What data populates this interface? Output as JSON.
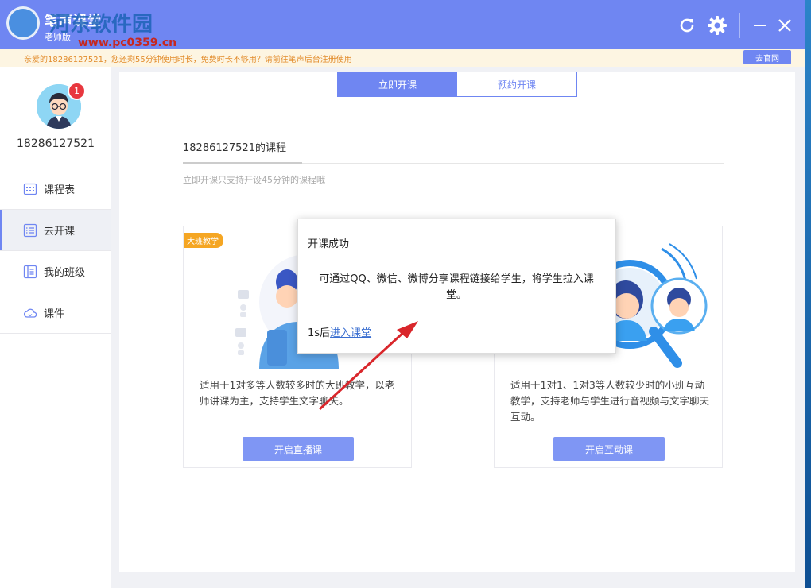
{
  "titlebar": {
    "title": "笔声课堂",
    "subtitle": "老师版",
    "watermark": "河东软件园",
    "watermark_url": "www.pc0359.cn",
    "refresh_icon": "refresh-icon",
    "settings_icon": "gear-icon",
    "minimize_icon": "minimize-icon",
    "close_icon": "close-icon"
  },
  "notice": {
    "text": "亲爱的18286127521，您还剩55分钟使用时长，免费时长不够用？请前往笔声后台注册使用",
    "site_button": "去官网"
  },
  "sidebar": {
    "notification_count": "1",
    "username": "18286127521",
    "items": [
      {
        "label": "课程表",
        "icon": "calendar-icon"
      },
      {
        "label": "去开课",
        "icon": "list-icon"
      },
      {
        "label": "我的班级",
        "icon": "class-icon"
      },
      {
        "label": "课件",
        "icon": "cloud-icon"
      }
    ],
    "active_index": 1
  },
  "main": {
    "tabs": [
      {
        "label": "立即开课",
        "active": true
      },
      {
        "label": "预约开课",
        "active": false
      }
    ],
    "course_title": "18286127521的课程",
    "hint": "立即开课只支持开设45分钟的课程哦",
    "cards": [
      {
        "tag": "大班教学",
        "desc": "适用于1对多等人数较多时的大班教学，以老师讲课为主，支持学生文字聊天。",
        "button": "开启直播课"
      },
      {
        "tag": "",
        "desc": "适用于1对1、1对3等人数较少时的小班互动教学，支持老师与学生进行音视频与文字聊天互动。",
        "button": "开启互动课"
      }
    ]
  },
  "modal": {
    "title": "开课成功",
    "message": "可通过QQ、微信、微博分享课程链接给学生，将学生拉入课堂。",
    "countdown": "1s后",
    "link": "进入课堂"
  },
  "colors": {
    "accent": "#6f86f2",
    "notice_text": "#e28b2a",
    "badge": "#e8373e",
    "tag": "#f5a623",
    "annotation_arrow": "#d9262b"
  }
}
